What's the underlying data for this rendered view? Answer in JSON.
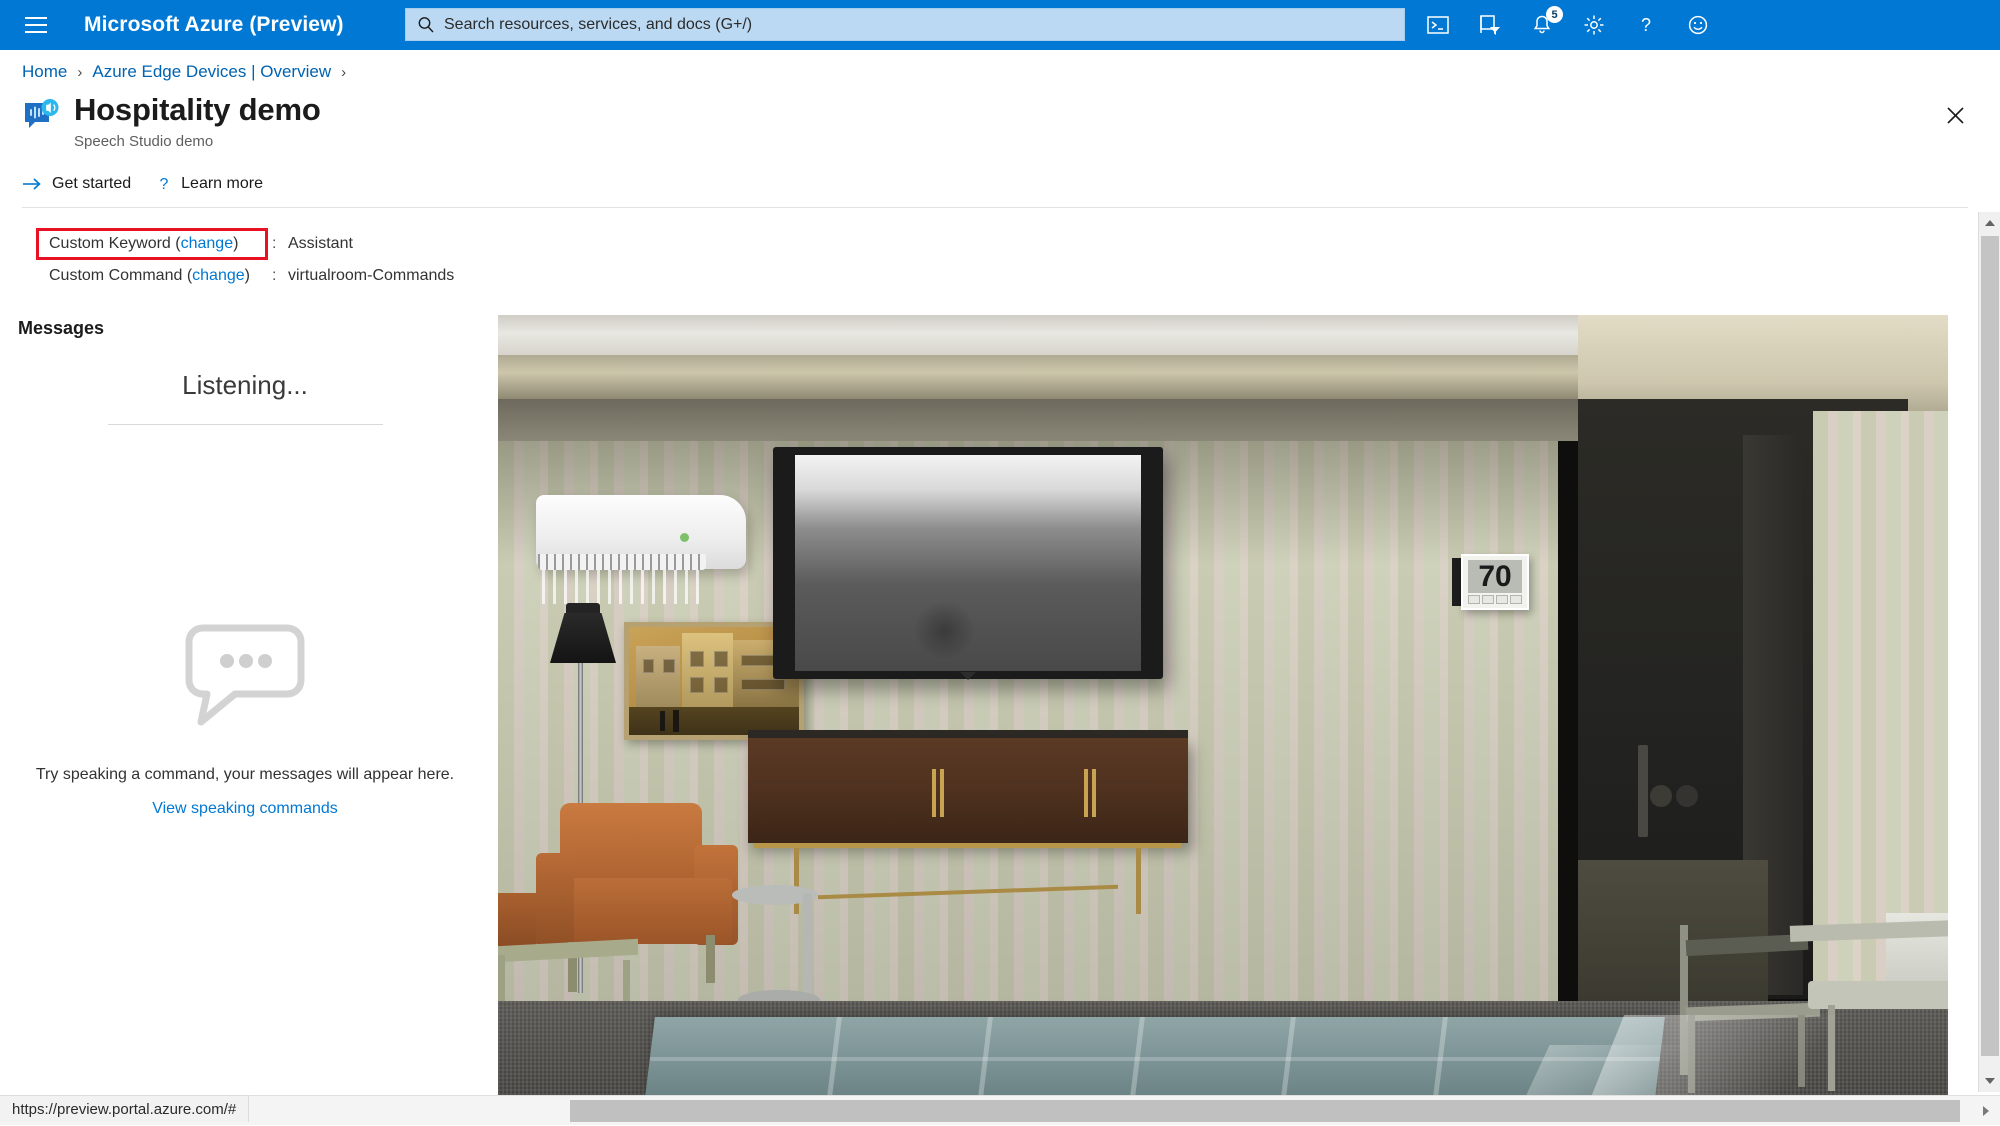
{
  "topbar": {
    "menu_icon": "hamburger-icon",
    "brand": "Microsoft Azure (Preview)",
    "search": {
      "icon": "search-icon",
      "placeholder": "Search resources, services, and docs (G+/)",
      "value": ""
    },
    "icons": [
      {
        "name": "cloud-shell-icon",
        "label": "Cloud Shell"
      },
      {
        "name": "directory-filter-icon",
        "label": "Directories + subscriptions"
      },
      {
        "name": "notifications-bell-icon",
        "label": "Notifications",
        "badge": "5"
      },
      {
        "name": "settings-gear-icon",
        "label": "Settings"
      },
      {
        "name": "help-question-icon",
        "label": "Help"
      },
      {
        "name": "feedback-smiley-icon",
        "label": "Feedback"
      }
    ],
    "accent_color": "#0078d4"
  },
  "breadcrumb": {
    "items": [
      "Home",
      "Azure Edge Devices | Overview"
    ],
    "separator": "›"
  },
  "header": {
    "logo_icon": "speech-service-icon",
    "title": "Hospitality demo",
    "subtitle": "Speech Studio demo",
    "close_icon": "close-icon"
  },
  "command_bar": {
    "items": [
      {
        "name": "get-started",
        "icon": "arrow-right-icon",
        "label": "Get started"
      },
      {
        "name": "learn-more",
        "icon": "question-mark-icon",
        "label": "Learn more"
      }
    ]
  },
  "properties": [
    {
      "label": "Custom Keyword",
      "change_label": "change",
      "colon": ":",
      "value": "Assistant",
      "highlighted": true
    },
    {
      "label": "Custom Command",
      "change_label": "change",
      "colon": ":",
      "value": "virtualroom-Commands",
      "highlighted": false
    }
  ],
  "highlight_color": "#e81123",
  "messages_panel": {
    "heading": "Messages",
    "status": "Listening...",
    "empty_icon": "chat-bubble-icon",
    "empty_text": "Try speaking a command, your messages will appear here.",
    "empty_link": "View speaking commands"
  },
  "room_preview": {
    "name": "hotel-room-render",
    "thermostat_value": "70",
    "alt": "Virtual hotel room with wall air conditioner, framed picture, floor lamp, flat-screen TV, thermostat, credenza, armchair, bed and dining chairs"
  },
  "scrollbars": {
    "vertical": {
      "up_icon": "chevron-up-icon",
      "down_icon": "chevron-down-icon"
    },
    "horizontal": {
      "right_icon": "chevron-right-icon"
    }
  },
  "status_bar": {
    "url": "https://preview.portal.azure.com/#"
  }
}
